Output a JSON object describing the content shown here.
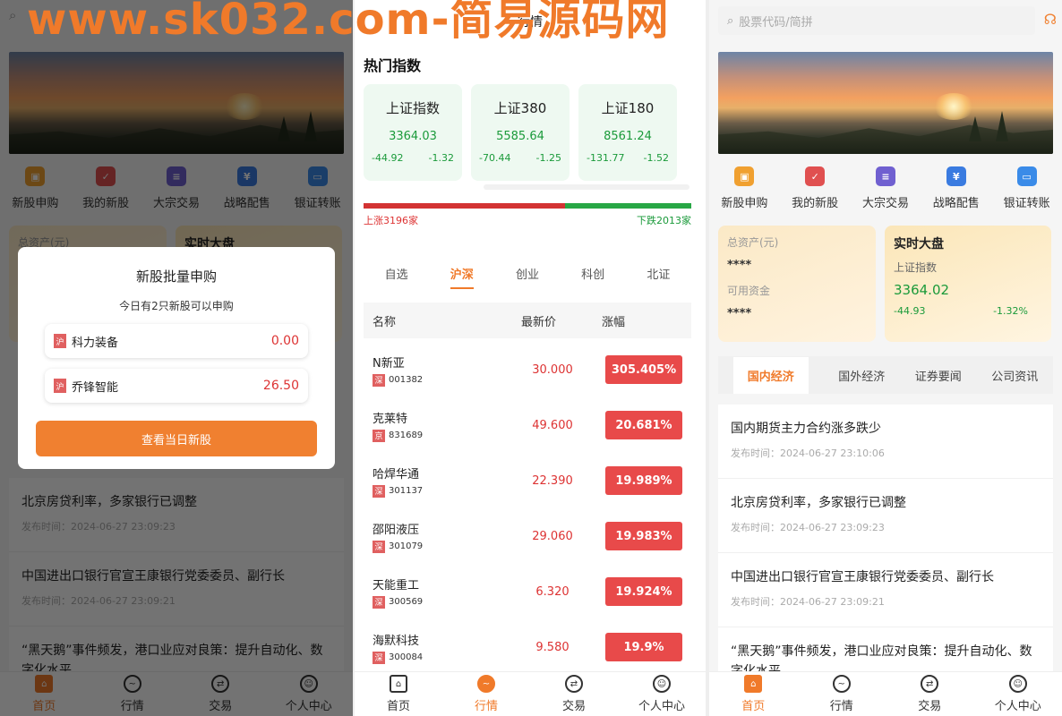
{
  "watermark": "www.sk032.com-简易源码网",
  "home": {
    "search_placeholder": "股票代码/简拼",
    "quick": [
      {
        "label": "新股申购",
        "icon": "ipo-icon",
        "color": "#f0a030",
        "glyph": "IPO"
      },
      {
        "label": "我的新股",
        "icon": "my-stock-icon",
        "color": "#e05050",
        "glyph": "✓"
      },
      {
        "label": "大宗交易",
        "icon": "block-trade-icon",
        "color": "#7060d0",
        "glyph": "≡"
      },
      {
        "label": "战略配售",
        "icon": "placement-icon",
        "color": "#3a7be0",
        "glyph": "¥"
      },
      {
        "label": "银证转账",
        "icon": "transfer-icon",
        "color": "#3a8be8",
        "glyph": "▭"
      }
    ],
    "asset": {
      "total_label": "总资产(元)",
      "total_value": "****",
      "avail_label": "可用资金",
      "avail_value": "****"
    },
    "market": {
      "title": "实时大盘",
      "index_name": "上证指数",
      "index_value": "3364.02",
      "change": "-44.93",
      "change_pct": "-1.32%"
    },
    "news_tabs": [
      "国内经济",
      "国外经济",
      "证券要闻",
      "公司资讯"
    ],
    "news": [
      {
        "title": "国内期货主力合约涨多跌少",
        "date": "发布时间：2024-06-27 23:10:06"
      },
      {
        "title": "北京房贷利率，多家银行已调整",
        "date": "发布时间：2024-06-27 23:09:23"
      },
      {
        "title": "中国进出口银行官宣王康银行党委委员、副行长",
        "date": "发布时间：2024-06-27 23:09:21"
      },
      {
        "title": "“黑天鹅”事件频发，港口业应对良策：提升自动化、数字化水平",
        "date": ""
      }
    ]
  },
  "modal": {
    "title": "新股批量申购",
    "subtitle": "今日有2只新股可以申购",
    "items": [
      {
        "tag": "沪",
        "name": "科力装备",
        "value": "0.00"
      },
      {
        "tag": "沪",
        "name": "乔锋智能",
        "value": "26.50"
      }
    ],
    "button": "查看当日新股"
  },
  "market": {
    "title": "行情",
    "hot_title": "热门指数",
    "indices": [
      {
        "name": "上证指数",
        "value": "3364.03",
        "change": "-44.92",
        "pct": "-1.32"
      },
      {
        "name": "上证380",
        "value": "5585.64",
        "change": "-70.44",
        "pct": "-1.25"
      },
      {
        "name": "上证180",
        "value": "8561.24",
        "change": "-131.77",
        "pct": "-1.52"
      }
    ],
    "up_label": "上涨3196家",
    "down_label": "下跌2013家",
    "up_fraction": 0.614,
    "tabs": [
      "自选",
      "沪深",
      "创业",
      "科创",
      "北证"
    ],
    "active_tab": 1,
    "headers": {
      "name": "名称",
      "price": "最新价",
      "change": "涨幅"
    },
    "stocks": [
      {
        "name": "N新亚",
        "tag": "深",
        "code": "001382",
        "price": "30.000",
        "change": "305.405%"
      },
      {
        "name": "克莱特",
        "tag": "京",
        "code": "831689",
        "price": "49.600",
        "change": "20.681%"
      },
      {
        "name": "哈焊华通",
        "tag": "深",
        "code": "301137",
        "price": "22.390",
        "change": "19.989%"
      },
      {
        "name": "邵阳液压",
        "tag": "深",
        "code": "301079",
        "price": "29.060",
        "change": "19.983%"
      },
      {
        "name": "天能重工",
        "tag": "深",
        "code": "300569",
        "price": "6.320",
        "change": "19.924%"
      },
      {
        "name": "海默科技",
        "tag": "深",
        "code": "300084",
        "price": "9.580",
        "change": "19.9%"
      }
    ]
  },
  "tabbar": [
    {
      "label": "首页",
      "icon": "home-icon"
    },
    {
      "label": "行情",
      "icon": "chart-icon"
    },
    {
      "label": "交易",
      "icon": "trade-icon"
    },
    {
      "label": "个人中心",
      "icon": "user-icon"
    }
  ]
}
